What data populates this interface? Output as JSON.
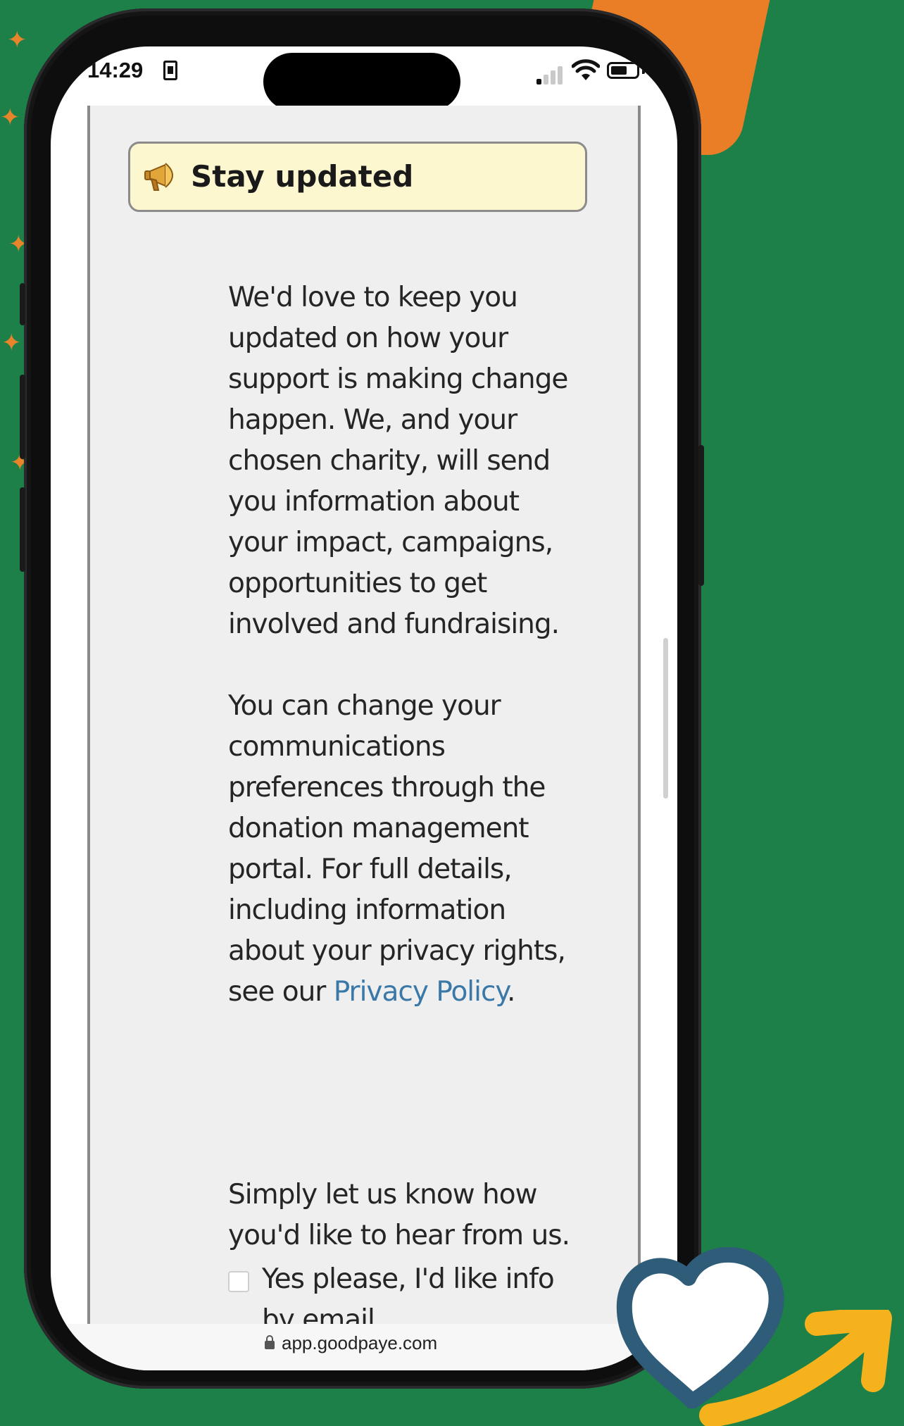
{
  "status_bar": {
    "time": "14:29"
  },
  "banner": {
    "title": "Stay updated",
    "icon": "megaphone-icon"
  },
  "paragraphs": {
    "p1": [
      "We'd love to keep you",
      "updated on how your",
      "support is making change",
      "happen. We, and your",
      "chosen charity, will send",
      "you information about",
      "your impact, campaigns,",
      "opportunities to get",
      "involved and fundraising."
    ],
    "p2_lines": [
      "You can change your",
      "communications",
      "preferences through the",
      "donation management",
      "portal. For full details,",
      "including information",
      "about your privacy rights,"
    ],
    "p2_last_prefix": "see our ",
    "p2_link": "Privacy Policy",
    "p2_last_suffix": ".",
    "p3": [
      "Simply let us know how",
      "you'd like to hear from us."
    ]
  },
  "email_option": {
    "label": "Yes please, I'd like info by email",
    "checked": false
  },
  "url_bar": {
    "url": "app.goodpaye.com"
  },
  "colors": {
    "background": "#1e8049",
    "banner_bg": "#fdf7cf",
    "link": "#3a78a8",
    "accent_orange": "#e97e26",
    "heart_outline": "#2f5c78",
    "arrow": "#f5b21c"
  }
}
